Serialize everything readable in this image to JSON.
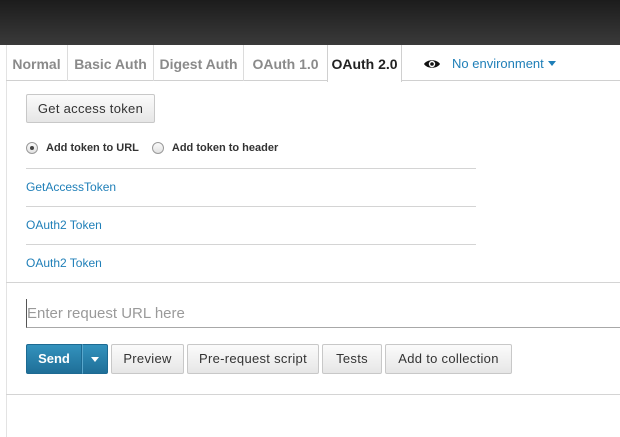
{
  "tabs": [
    {
      "label": "Normal"
    },
    {
      "label": "Basic Auth"
    },
    {
      "label": "Digest Auth"
    },
    {
      "label": "OAuth 1.0"
    },
    {
      "label": "OAuth 2.0"
    }
  ],
  "active_tab": "OAuth 2.0",
  "environment": {
    "label": "No environment",
    "icon": "eye-icon"
  },
  "oauth2": {
    "get_token_button": "Get access token",
    "radio_url_label": "Add token to URL",
    "radio_header_label": "Add token to header",
    "selected_option": "Add token to URL",
    "tokens": [
      "GetAccessToken",
      "OAuth2 Token",
      "OAuth2 Token"
    ]
  },
  "request": {
    "url_placeholder": "Enter request URL here",
    "url_value": "",
    "send_label": "Send",
    "preview_label": "Preview",
    "prerequest_label": "Pre-request script",
    "tests_label": "Tests",
    "collection_label": "Add to collection"
  },
  "colors": {
    "accent": "#1f7fb8",
    "send": "#2a85b0",
    "topbar": "#2b2b2b"
  }
}
